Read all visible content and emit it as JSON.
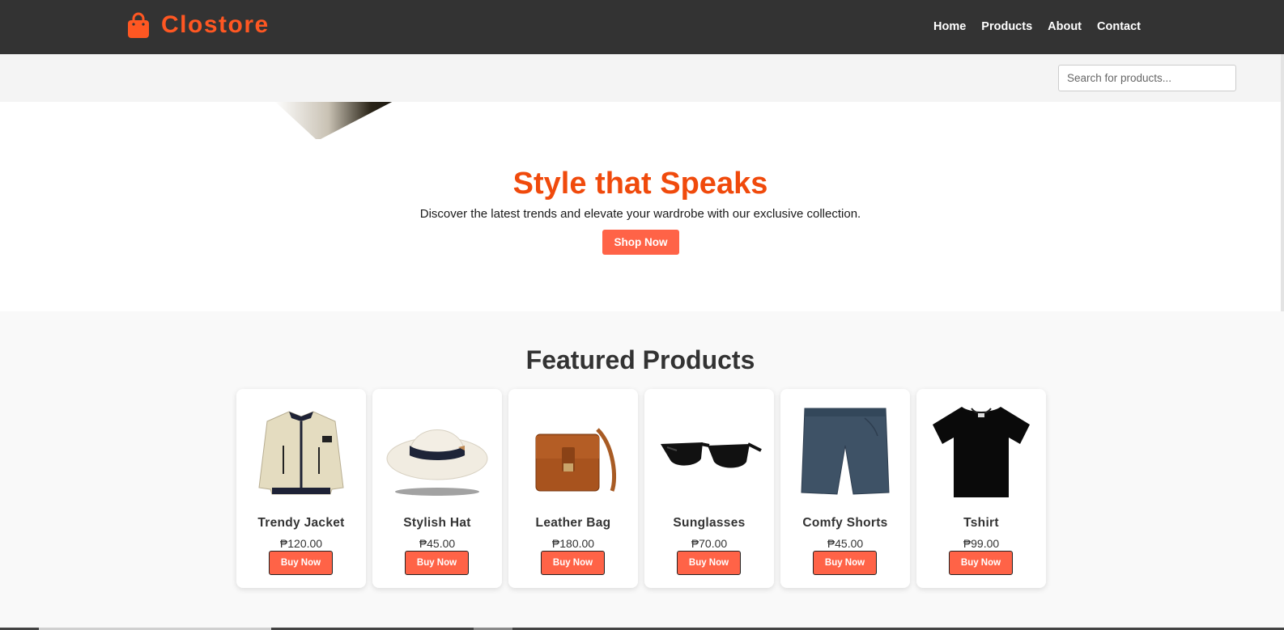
{
  "brand": {
    "name": "Clostore",
    "icon": "shopping-bag-icon",
    "color": "#ff5722"
  },
  "nav": {
    "items": [
      "Home",
      "Products",
      "About",
      "Contact"
    ]
  },
  "search": {
    "placeholder": "Search for products..."
  },
  "hero": {
    "title": "Style that Speaks",
    "subtitle": "Discover the latest trends and elevate your wardrobe with our exclusive collection.",
    "cta": "Shop Now"
  },
  "featured": {
    "title": "Featured Products",
    "products": [
      {
        "name": "Trendy Jacket",
        "price": "₱120.00",
        "button": "Buy Now"
      },
      {
        "name": "Stylish Hat",
        "price": "₱45.00",
        "button": "Buy Now"
      },
      {
        "name": "Leather Bag",
        "price": "₱180.00",
        "button": "Buy Now"
      },
      {
        "name": "Sunglasses",
        "price": "₱70.00",
        "button": "Buy Now"
      },
      {
        "name": "Comfy Shorts",
        "price": "₱45.00",
        "button": "Buy Now"
      },
      {
        "name": "Tshirt",
        "price": "₱99.00",
        "button": "Buy Now"
      }
    ]
  },
  "colors": {
    "header": "#333333",
    "accent": "#ff6347",
    "title": "#f04a0c"
  }
}
